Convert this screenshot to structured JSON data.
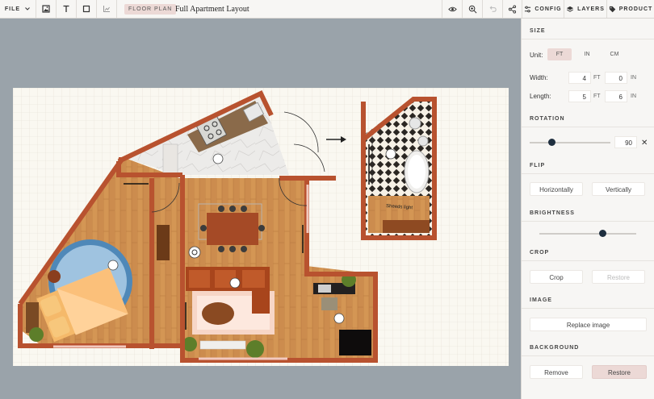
{
  "toolbar": {
    "file_label": "FILE",
    "badge": "FLOOR PLAN",
    "title": "Full Apartment Layout",
    "tabs": [
      {
        "label": "CONFIG",
        "icon": "sliders-icon"
      },
      {
        "label": "LAYERS",
        "icon": "layers-icon"
      },
      {
        "label": "PRODUCT",
        "icon": "tag-icon"
      }
    ]
  },
  "plan": {
    "bathroom_label": "Sheeds light"
  },
  "panel": {
    "size": {
      "heading": "SIZE",
      "unit_label": "Unit:",
      "units": [
        "FT",
        "IN",
        "CM"
      ],
      "selected_unit": "FT",
      "width_label": "Width:",
      "width_ft": "4",
      "width_in": "0",
      "length_label": "Length:",
      "length_ft": "5",
      "length_in": "6",
      "ft": "FT",
      "in": "IN"
    },
    "rotation": {
      "heading": "ROTATION",
      "value": "90",
      "fraction": 0.27,
      "clear": "✕"
    },
    "flip": {
      "heading": "FLIP",
      "horizontal": "Horizontally",
      "vertical": "Vertically"
    },
    "brightness": {
      "heading": "BRIGHTNESS",
      "fraction": 0.65
    },
    "crop": {
      "heading": "CROP",
      "crop": "Crop",
      "restore": "Restore"
    },
    "image": {
      "heading": "IMAGE",
      "replace": "Replace image"
    },
    "background": {
      "heading": "BACKGROUND",
      "remove": "Remove",
      "restore": "Restore"
    }
  },
  "colors": {
    "wall": "#b8522f",
    "wood": "#cc8c4e",
    "accent": "#ecd9d6",
    "slider_knob": "#1f2f3f"
  }
}
